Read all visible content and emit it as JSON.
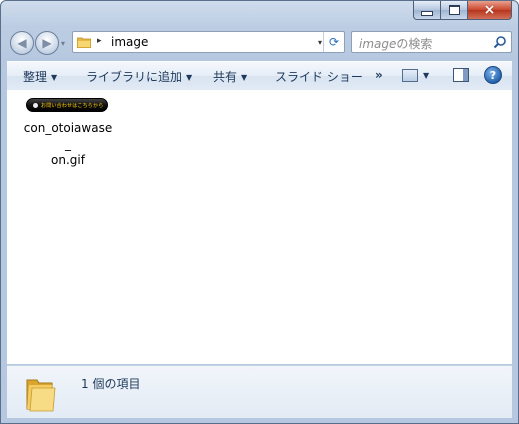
{
  "window": {
    "caption_buttons": {
      "minimize": "minimize-icon",
      "maximize": "maximize-icon",
      "close": "×"
    }
  },
  "nav": {
    "back_glyph": "◀",
    "forward_glyph": "▶",
    "history_arrow": "▾"
  },
  "address": {
    "separator": "▸",
    "path_segment": "image",
    "dropdown": "▾",
    "refresh_glyph": "⟳"
  },
  "search": {
    "placeholder_italic": "image",
    "placeholder_rest": "の検索"
  },
  "commandbar": {
    "organize": "整理",
    "library": "ライブラリに追加",
    "share": "共有",
    "slideshow": "スライド ショー",
    "more": "»",
    "help": "?"
  },
  "files": [
    {
      "name": "con_otoiawase_on.gif",
      "name_line1": "con_otoiawase_",
      "name_line2": "on.gif",
      "thumbnail_text": "お問い合わせはこちらから"
    }
  ],
  "details": {
    "item_count": "1 個の項目"
  },
  "colors": {
    "frame": "#b6c8df",
    "command_text": "#1e395b",
    "close_button": "#c9462c",
    "thumbnail_text": "#ffd000"
  }
}
